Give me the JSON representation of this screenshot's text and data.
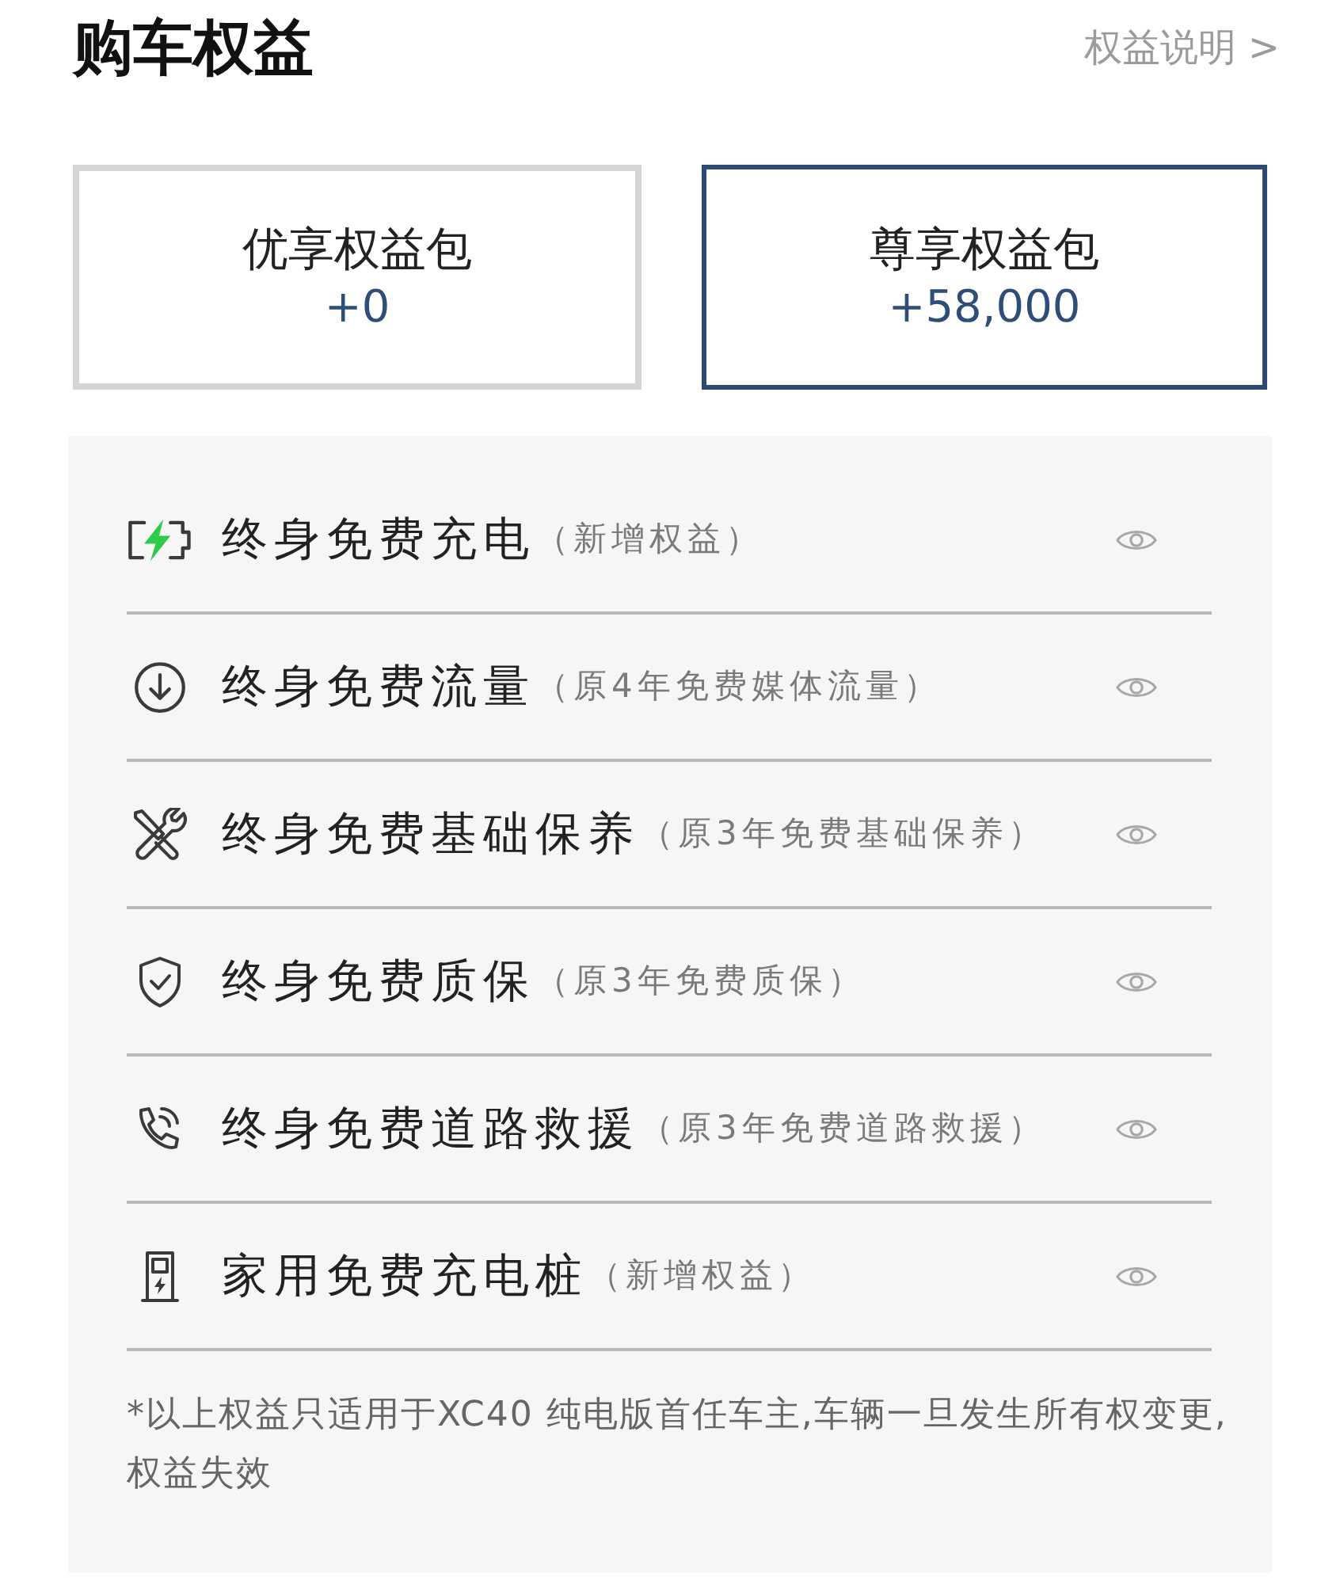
{
  "header": {
    "title": "购车权益",
    "link": "权益说明 >"
  },
  "packages": [
    {
      "name": "优享权益包",
      "value": "+0",
      "selected": false
    },
    {
      "name": "尊享权益包",
      "value": "+58,000",
      "selected": true
    }
  ],
  "benefits": [
    {
      "label": "终身免费充电",
      "note": "（新增权益）"
    },
    {
      "label": "终身免费流量",
      "note": "（原4年免费媒体流量）"
    },
    {
      "label": "终身免费基础保养",
      "note": "（原3年免费基础保养）"
    },
    {
      "label": "终身免费质保",
      "note": "（原3年免费质保）"
    },
    {
      "label": "终身免费道路救援",
      "note": "（原3年免费道路救援）"
    },
    {
      "label": "家用免费充电桩",
      "note": "（新增权益）"
    }
  ],
  "footnote": "*以上权益只适用于XC40 纯电版首任车主,车辆一旦发生所有权变更,权益失效"
}
